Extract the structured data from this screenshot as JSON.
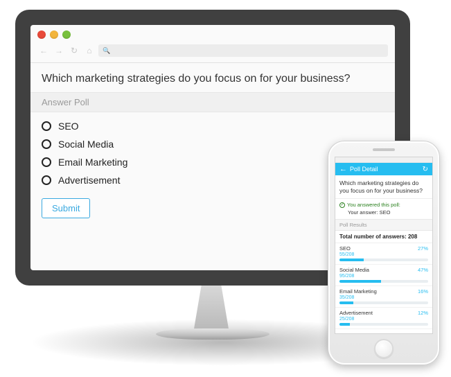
{
  "poll": {
    "question": "Which marketing strategies do you focus on for your business?",
    "section_label": "Answer Poll",
    "options": [
      "SEO",
      "Social Media",
      "Email Marketing",
      "Advertisement"
    ],
    "submit_label": "Submit"
  },
  "phone": {
    "nav_title": "Poll Detail",
    "question": "Which marketing strategies do you focus on for your business?",
    "answered_label": "You answered this poll:",
    "your_answer_prefix": "Your answer: ",
    "your_answer_value": "SEO",
    "results_section": "Poll Results",
    "total_prefix": "Total number of answers: ",
    "total_value": "208",
    "results": [
      {
        "label": "SEO",
        "count": "55/208",
        "pct": "27%",
        "pct_num": 27
      },
      {
        "label": "Social Media",
        "count": "95/208",
        "pct": "47%",
        "pct_num": 47
      },
      {
        "label": "Email Marketing",
        "count": "35/208",
        "pct": "16%",
        "pct_num": 16
      },
      {
        "label": "Advertisement",
        "count": "25/208",
        "pct": "12%",
        "pct_num": 12
      }
    ]
  },
  "browser": {
    "icons": {
      "back": "←",
      "forward": "→",
      "refresh": "↻",
      "home": "⌂",
      "search": "🔍"
    }
  }
}
